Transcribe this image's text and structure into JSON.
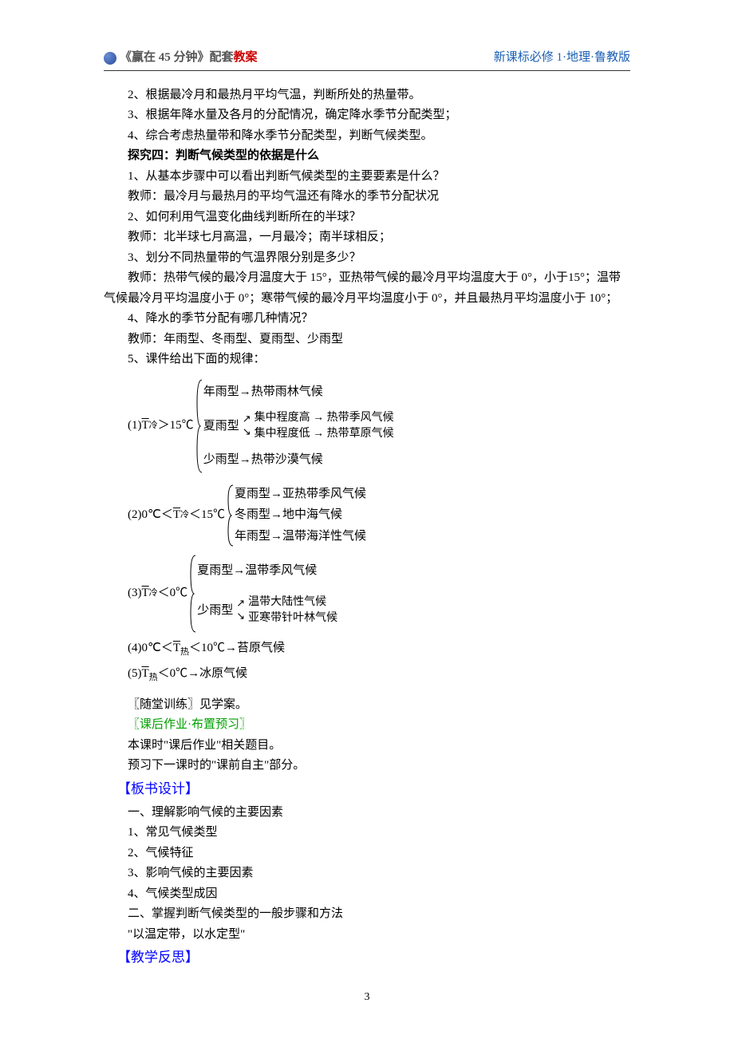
{
  "header": {
    "left_prefix": "《赢在 45 分钟》配套",
    "left_suffix": "教案",
    "right": "新课标必修 1·地理·鲁教版"
  },
  "body": {
    "p1": "2、根据最冷月和最热月平均气温，判断所处的热量带。",
    "p2": "3、根据年降水量及各月的分配情况，确定降水季节分配类型；",
    "p3": "4、综合考虑热量带和降水季节分配类型，判断气候类型。",
    "h1": "探究四：判断气候类型的依据是什么",
    "p4": "1、从基本步骤中可以看出判断气候类型的主要要素是什么？",
    "p5": "教师：最冷月与最热月的平均气温还有降水的季节分配状况",
    "p6": "2、如何利用气温变化曲线判断所在的半球？",
    "p7": "教师：北半球七月高温，一月最冷；南半球相反；",
    "p8": "3、划分不同热量带的气温界限分别是多少？",
    "p9": "教师：热带气候的最冷月温度大于 15°，亚热带气候的最冷月平均温度大于 0°，小于15°；温带气候最冷月平均温度小于 0°；寒带气候的最冷月平均温度小于 0°，并且最热月平均温度小于 10°；",
    "p10": "4、降水的季节分配有哪几种情况？",
    "p11": "教师：年雨型、冬雨型、夏雨型、少雨型",
    "p12": "5、课件给出下面的规律：",
    "rule1": {
      "label_prefix": "(1)",
      "label_cond": "＞15℃",
      "line_a": "年雨型→热带雨林气候",
      "line_b_label": "夏雨型",
      "line_b_top": "集中程度高 → 热带季风气候",
      "line_b_bot": "集中程度低 → 热带草原气候",
      "line_c": "少雨型→热带沙漠气候"
    },
    "rule2": {
      "label_prefix": "(2)0℃＜",
      "label_cond": "＜15℃",
      "line_a": "夏雨型→亚热带季风气候",
      "line_b": "冬雨型→地中海气候",
      "line_c": "年雨型→温带海洋性气候"
    },
    "rule3": {
      "label_prefix": "(3)",
      "label_cond": "＜0℃",
      "line_a": "夏雨型→温带季风气候",
      "line_b_label": "少雨型",
      "line_b_top": "温带大陆性气候",
      "line_b_bot": "亚寒带针叶林气候"
    },
    "rule4": "(4)0℃＜T̅热＜10℃→苔原气候",
    "rule5": "(5)T̅热＜0℃→冰原气候",
    "p13": "〖随堂训练〗见学案。",
    "h2": "〖课后作业·布置预习〗",
    "p14": "本课时\"课后作业\"相关题目。",
    "p15": "预习下一课时的\"课前自主\"部分。",
    "h3": "【板书设计】",
    "p16": "一、理解影响气候的主要因素",
    "p17": "1、常见气候类型",
    "p18": "2、气候特征",
    "p19": "3、影响气候的主要因素",
    "p20": "4、气候类型成因",
    "p21": "二、掌握判断气候类型的一般步骤和方法",
    "p22": "\"以温定带，以水定型\"",
    "h4": "【教学反思】"
  },
  "footer": {
    "page_number": "3"
  }
}
